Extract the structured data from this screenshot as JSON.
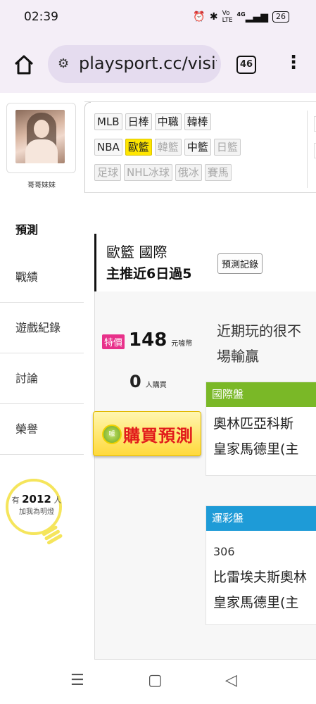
{
  "status": {
    "time": "02:39",
    "net": "4G",
    "battery": "26"
  },
  "browser": {
    "url": "playsport.cc/visit",
    "tabs_count": "46"
  },
  "profile": {
    "username": "哥哥妹妹"
  },
  "leagues": {
    "row1": [
      {
        "label": "MLB",
        "state": "normal"
      },
      {
        "label": "日棒",
        "state": "normal"
      },
      {
        "label": "中職",
        "state": "normal"
      },
      {
        "label": "韓棒",
        "state": "normal"
      }
    ],
    "row2": [
      {
        "label": "NBA",
        "state": "normal"
      },
      {
        "label": "歐籃",
        "state": "active"
      },
      {
        "label": "韓籃",
        "state": "dim"
      },
      {
        "label": "中籃",
        "state": "normal"
      },
      {
        "label": "日籃",
        "state": "dim"
      }
    ],
    "row3": [
      {
        "label": "足球",
        "state": "dim"
      },
      {
        "label": "NHL冰球",
        "state": "dim"
      },
      {
        "label": "俄冰",
        "state": "dim"
      },
      {
        "label": "賽馬",
        "state": "dim"
      }
    ]
  },
  "sidenav": [
    "預測",
    "戰績",
    "遊戲紀錄",
    "討論",
    "榮譽"
  ],
  "lamp": {
    "prefix": "有",
    "count": "2012",
    "suffix": "人",
    "line2": "加我為明燈"
  },
  "header": {
    "league_line": "歐籃 國際",
    "streak": "主推近6日過5",
    "record_button": "預測記錄"
  },
  "offer": {
    "badge": "特價",
    "price": "148",
    "price_unit": "元噱幣",
    "buyers": "0",
    "buyers_unit": "人購買",
    "buy_label": "購買預測"
  },
  "comment": {
    "line1": "近期玩的很不",
    "line2": "場輸贏"
  },
  "intl_panel": {
    "title": "國際盤",
    "color": "#7ab827",
    "team1": "奧林匹亞科斯",
    "team2": "皇家馬德里(主"
  },
  "lottery_panel": {
    "title": "運彩盤",
    "color": "#1e9bd7",
    "game_no": "306",
    "team1": "比雷埃夫斯奧林",
    "team2": "皇家馬德里(主"
  }
}
